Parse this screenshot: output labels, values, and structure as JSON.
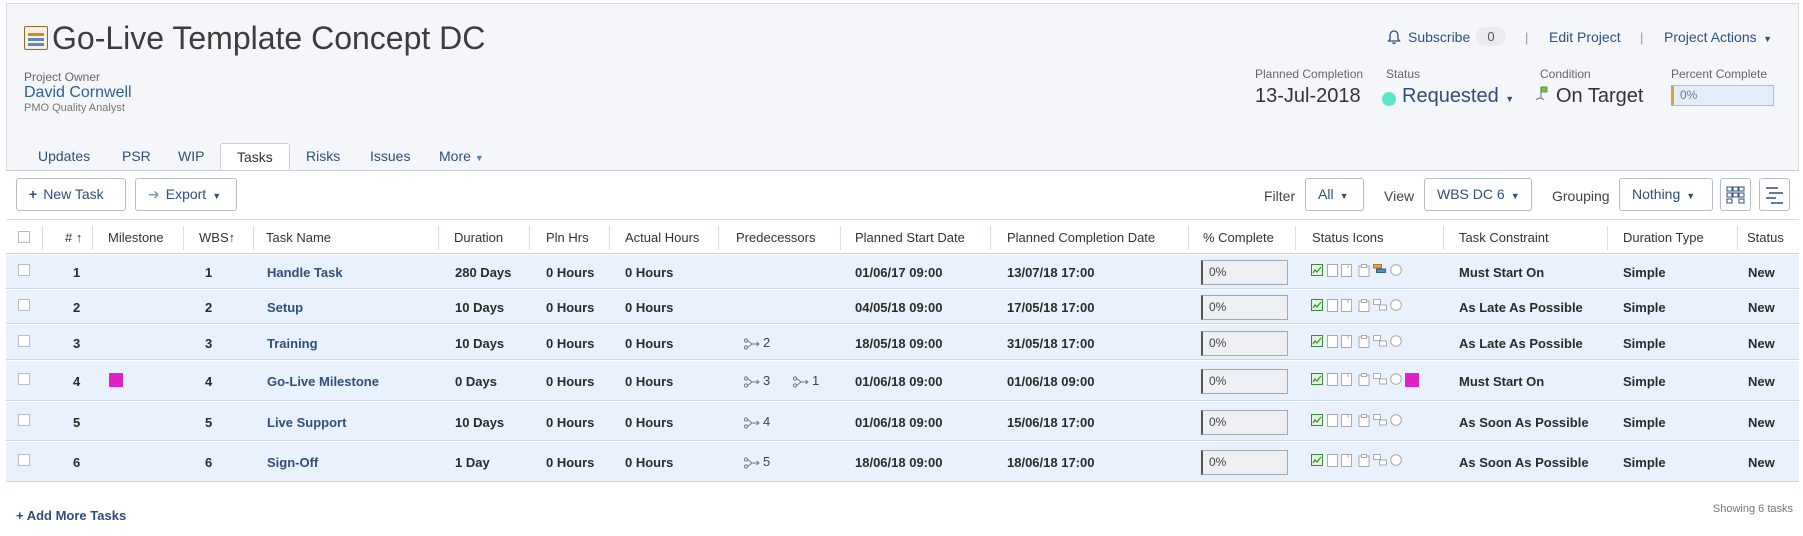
{
  "project": {
    "title": "Go-Live Template Concept DC",
    "owner_label": "Project Owner",
    "owner_name": "David Cornwell",
    "owner_role": "PMO Quality Analyst"
  },
  "actions": {
    "subscribe": "Subscribe",
    "subscribe_count": "0",
    "separator": "|",
    "edit_project": "Edit Project",
    "project_actions": "Project Actions"
  },
  "stats": {
    "planned_completion_label": "Planned Completion",
    "planned_completion": "13-Jul-2018",
    "status_label": "Status",
    "status": "Requested",
    "condition_label": "Condition",
    "condition": "On Target",
    "percent_label": "Percent Complete",
    "percent": "0%"
  },
  "tabs": [
    {
      "label": "Updates"
    },
    {
      "label": "PSR"
    },
    {
      "label": "WIP"
    },
    {
      "label": "Tasks"
    },
    {
      "label": "Risks"
    },
    {
      "label": "Issues"
    },
    {
      "label": "More"
    }
  ],
  "toolbar": {
    "new_task": "New Task",
    "export": "Export",
    "filter_label": "Filter",
    "filter_value": "All",
    "view_label": "View",
    "view_value": "WBS DC 6",
    "grouping_label": "Grouping",
    "grouping_value": "Nothing"
  },
  "columns": {
    "num": "#",
    "milestone": "Milestone",
    "wbs": "WBS",
    "task_name": "Task Name",
    "duration": "Duration",
    "pln_hrs": "Pln Hrs",
    "actual_hours": "Actual Hours",
    "predecessors": "Predecessors",
    "planned_start": "Planned Start Date",
    "planned_completion": "Planned Completion Date",
    "pct_complete": "% Complete",
    "status_icons": "Status Icons",
    "task_constraint": "Task Constraint",
    "duration_type": "Duration Type",
    "status": "Status"
  },
  "rows": [
    {
      "num": "1",
      "wbs": "1",
      "name": "Handle Task",
      "duration": "280 Days",
      "pln_hrs": "0 Hours",
      "actual": "0 Hours",
      "pred1": "",
      "pred2": "",
      "start": "01/06/17 09:00",
      "end": "13/07/18 17:00",
      "pct": "0%",
      "constraint": "Must Start On",
      "dtype": "Simple",
      "status": "New",
      "milestone": false
    },
    {
      "num": "2",
      "wbs": "2",
      "name": "Setup",
      "duration": "10 Days",
      "pln_hrs": "0 Hours",
      "actual": "0 Hours",
      "pred1": "",
      "pred2": "",
      "start": "04/05/18 09:00",
      "end": "17/05/18 17:00",
      "pct": "0%",
      "constraint": "As Late As Possible",
      "dtype": "Simple",
      "status": "New",
      "milestone": false
    },
    {
      "num": "3",
      "wbs": "3",
      "name": "Training",
      "duration": "10 Days",
      "pln_hrs": "0 Hours",
      "actual": "0 Hours",
      "pred1": "2",
      "pred2": "",
      "start": "18/05/18 09:00",
      "end": "31/05/18 17:00",
      "pct": "0%",
      "constraint": "As Late As Possible",
      "dtype": "Simple",
      "status": "New",
      "milestone": false
    },
    {
      "num": "4",
      "wbs": "4",
      "name": "Go-Live Milestone",
      "duration": "0 Days",
      "pln_hrs": "0 Hours",
      "actual": "0 Hours",
      "pred1": "3",
      "pred2": "1",
      "start": "01/06/18 09:00",
      "end": "01/06/18 09:00",
      "pct": "0%",
      "constraint": "Must Start On",
      "dtype": "Simple",
      "status": "New",
      "milestone": true
    },
    {
      "num": "5",
      "wbs": "5",
      "name": "Live Support",
      "duration": "10 Days",
      "pln_hrs": "0 Hours",
      "actual": "0 Hours",
      "pred1": "4",
      "pred2": "",
      "start": "01/06/18 09:00",
      "end": "15/06/18 17:00",
      "pct": "0%",
      "constraint": "As Soon As Possible",
      "dtype": "Simple",
      "status": "New",
      "milestone": false
    },
    {
      "num": "6",
      "wbs": "6",
      "name": "Sign-Off",
      "duration": "1 Day",
      "pln_hrs": "0 Hours",
      "actual": "0 Hours",
      "pred1": "5",
      "pred2": "",
      "start": "18/06/18 09:00",
      "end": "18/06/18 17:00",
      "pct": "0%",
      "constraint": "As Soon As Possible",
      "dtype": "Simple",
      "status": "New",
      "milestone": false
    }
  ],
  "footer": {
    "add_more": "+ Add More Tasks",
    "showing": "Showing 6 tasks"
  },
  "colors": {
    "accent": "#2f4f7a",
    "status_dot": "#5ee5c8",
    "milestone": "#e020c8",
    "row_bg": "#e8f1fc"
  }
}
